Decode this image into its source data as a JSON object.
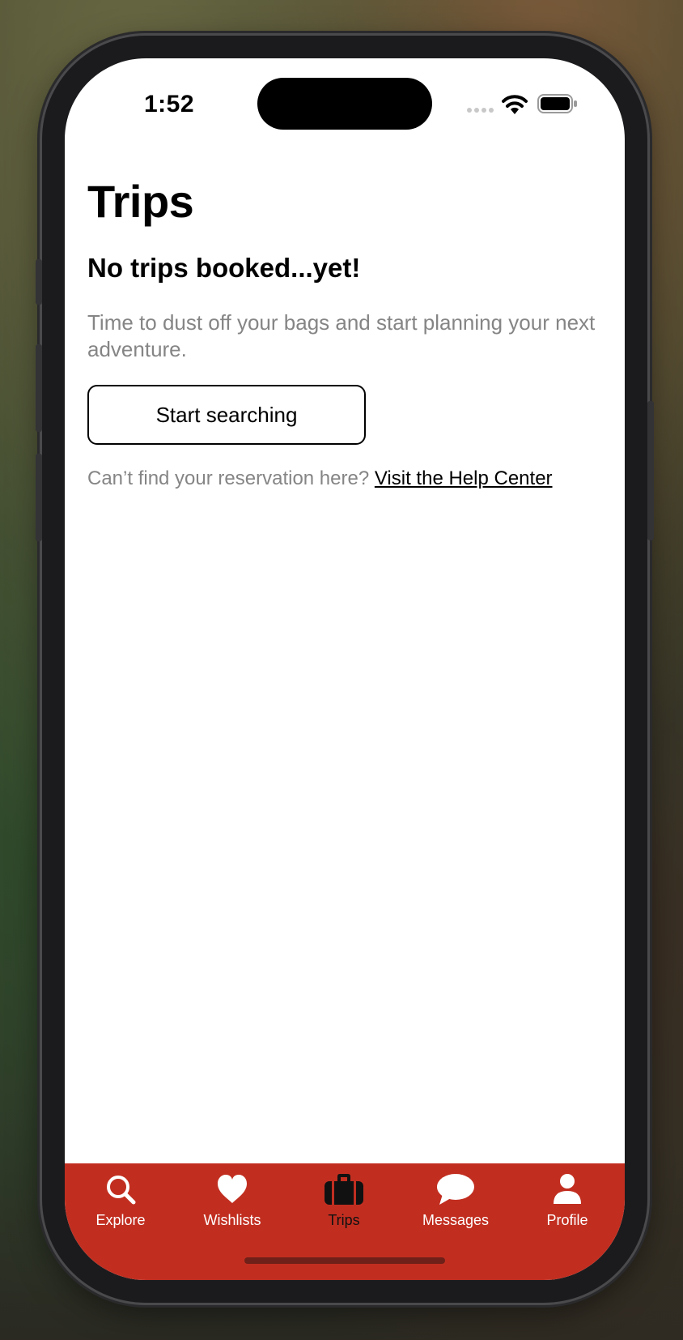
{
  "status_bar": {
    "time": "1:52",
    "icons": [
      "cellular-signal-icon",
      "wifi-icon",
      "battery-icon"
    ]
  },
  "page": {
    "title": "Trips",
    "empty_state": {
      "heading": "No trips booked...yet!",
      "description": "Time to dust off your bags and start planning your next adventure.",
      "button_label": "Start searching",
      "help_prompt": "Can’t find your reservation here?",
      "help_link": "Visit the Help Center"
    }
  },
  "tab_bar": {
    "background_color": "#c12e20",
    "active_tab": "Trips",
    "tabs": [
      {
        "label": "Explore",
        "icon": "search-icon"
      },
      {
        "label": "Wishlists",
        "icon": "heart-icon"
      },
      {
        "label": "Trips",
        "icon": "suitcase-icon"
      },
      {
        "label": "Messages",
        "icon": "chat-bubble-icon"
      },
      {
        "label": "Profile",
        "icon": "person-icon"
      }
    ]
  }
}
